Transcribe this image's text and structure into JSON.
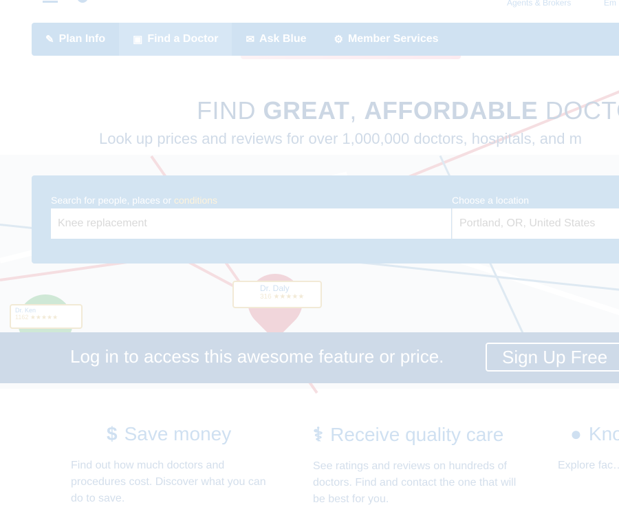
{
  "header": {
    "agents_link": "Agents & Brokers",
    "employers_link": "Em"
  },
  "nav": {
    "items": [
      {
        "label": "Plan Info",
        "icon": "clipboard-icon"
      },
      {
        "label": "Find a Doctor",
        "icon": "doctor-bag-icon"
      },
      {
        "label": "Ask Blue",
        "icon": "chat-bubble-icon"
      },
      {
        "label": "Member Services",
        "icon": "gear-icon"
      }
    ]
  },
  "hero": {
    "title_pre": "FIND ",
    "title_bold1": "GREAT",
    "title_comma": ", ",
    "title_bold2": "AFFORDABLE",
    "title_post": " DOCTORS",
    "subtitle": "Look up prices and reviews for over 1,000,000 doctors, hospitals, and m"
  },
  "search": {
    "label_pre": "Search for people, places or ",
    "label_highlight": "conditions",
    "query_value": "Knee replacement",
    "location_label": "Choose a location",
    "location_value": "Portland, OR, United States"
  },
  "markers": [
    {
      "name": "Dr. Daly",
      "rating": "316 ★★★★★"
    },
    {
      "name": "Dr. Ken",
      "rating": "1162 ★★★★★"
    }
  ],
  "login_band": {
    "text": "Log in to access this awesome feature or price.",
    "signup_label": "Sign Up Free"
  },
  "features": [
    {
      "icon": "dollar-icon",
      "title": "Save money",
      "desc": "Find out how much doctors and procedures cost. Discover what you can do to save."
    },
    {
      "icon": "stethoscope-icon",
      "title": "Receive quality care",
      "desc": "See ratings and reviews on hundreds of doctors. Find and contact the one that will be best for you."
    },
    {
      "icon": "map-pin-icon",
      "title": "Kno",
      "desc": "Explore fac… information"
    }
  ],
  "colors": {
    "brand_blue": "#2b77c4",
    "nav_blue": "#2f7fc8",
    "band_blue": "#255d9a",
    "highlight": "#ffd066"
  }
}
